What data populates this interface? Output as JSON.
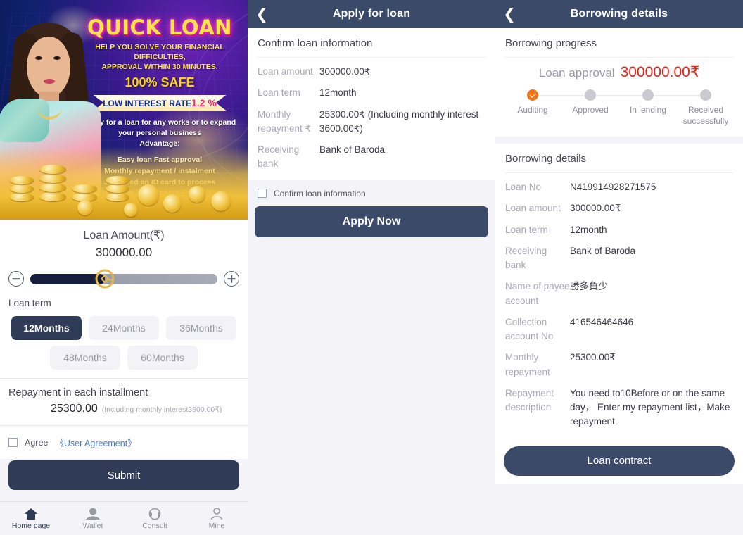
{
  "banner": {
    "title": "QUICK LOAN",
    "subtitle_line1": "HELP YOU SOLVE YOUR FINANCIAL DIFFICULTIES,",
    "subtitle_line2": "APPROVAL WITHIN 30 MINUTES.",
    "safe": "100% SAFE",
    "ribbon_text": "LOW INTEREST RATE",
    "ribbon_rate": "1.2 %",
    "body_line1": "Apply for a loan for any works or to expand",
    "body_line2": "your personal business",
    "body_line3": "Advantage:",
    "bullets": [
      "Easy loan Fast approval",
      "Monthly repayment / instalment",
      "Just need an ID card to process"
    ],
    "bullet_min_prefix": "Minimum loan amount ",
    "bullet_min_value": "Rs 100000",
    "bullet_upto_prefix": "Up to ",
    "bullet_upto_value": "Rs 2000000"
  },
  "home": {
    "amount_label": "Loan Amount(₹)",
    "amount_value": "300000.00",
    "minus_icon": "minus-circle-icon",
    "plus_icon": "plus-circle-icon",
    "slider_percent": 40,
    "term_label": "Loan term",
    "terms_row1": [
      {
        "label": "12Months",
        "active": true
      },
      {
        "label": "24Months",
        "active": false
      },
      {
        "label": "36Months",
        "active": false
      }
    ],
    "terms_row2": [
      {
        "label": "48Months",
        "active": false
      },
      {
        "label": "60Months",
        "active": false
      }
    ],
    "repay_title": "Repayment in each installment",
    "repay_amount": "25300.00",
    "repay_note": "(Including monthly interest3600.00₹)",
    "agree_text": "Agree",
    "agree_link": "《User Agreement》",
    "submit_label": "Submit"
  },
  "tabbar": {
    "items": [
      {
        "label": "Home page",
        "icon": "home-icon",
        "active": true
      },
      {
        "label": "Wallet",
        "icon": "wallet-icon",
        "active": false
      },
      {
        "label": "Consult",
        "icon": "headset-icon",
        "active": false
      },
      {
        "label": "Mine",
        "icon": "person-icon",
        "active": false
      }
    ]
  },
  "apply": {
    "header_title": "Apply for loan",
    "back_icon": "chevron-left-icon",
    "section_title": "Confirm loan information",
    "rows": [
      {
        "key": "Loan amount",
        "value": "300000.00₹"
      },
      {
        "key": "Loan term",
        "value": "12month"
      },
      {
        "key": "Monthly repayment ₹",
        "value": "25300.00₹ (Including monthly interest 3600.00₹)"
      },
      {
        "key": "Receiving bank",
        "value": "Bank of Baroda"
      }
    ],
    "confirm_checkbox_label": "Confirm loan information",
    "apply_button": "Apply Now"
  },
  "details": {
    "header_title": "Borrowing details",
    "back_icon": "chevron-left-icon",
    "progress_section_title": "Borrowing progress",
    "progress_label": "Loan approval",
    "progress_amount": "300000.00₹",
    "steps": [
      {
        "label": "Auditing",
        "done": true
      },
      {
        "label": "Approved",
        "done": false
      },
      {
        "label": "In lending",
        "done": false
      },
      {
        "label": "Received successfully",
        "done": false
      }
    ],
    "details_section_title": "Borrowing details",
    "rows": [
      {
        "key": "Loan No",
        "value": "N419914928271575"
      },
      {
        "key": "Loan amount",
        "value": "300000.00₹"
      },
      {
        "key": "Loan term",
        "value": "12month"
      },
      {
        "key": "Receiving bank",
        "value": "Bank of Baroda"
      },
      {
        "key": "Name of payee account",
        "value": "勝多負少"
      },
      {
        "key": "Collection account No",
        "value": "416546464646"
      },
      {
        "key": "Monthly repayment",
        "value": "25300.00₹"
      },
      {
        "key": "Repayment description",
        "value": "You need to10Before or on the same day， Enter my repayment list，Make repayment"
      }
    ],
    "contract_button": "Loan contract"
  },
  "colors": {
    "header_navy": "#3c4a69",
    "accent_navy": "#2f3b57",
    "amount_red": "#f41b12",
    "step_orange": "#f47216",
    "page_bg": "#f4f4f8",
    "slider_gold": "#e3b84a"
  }
}
